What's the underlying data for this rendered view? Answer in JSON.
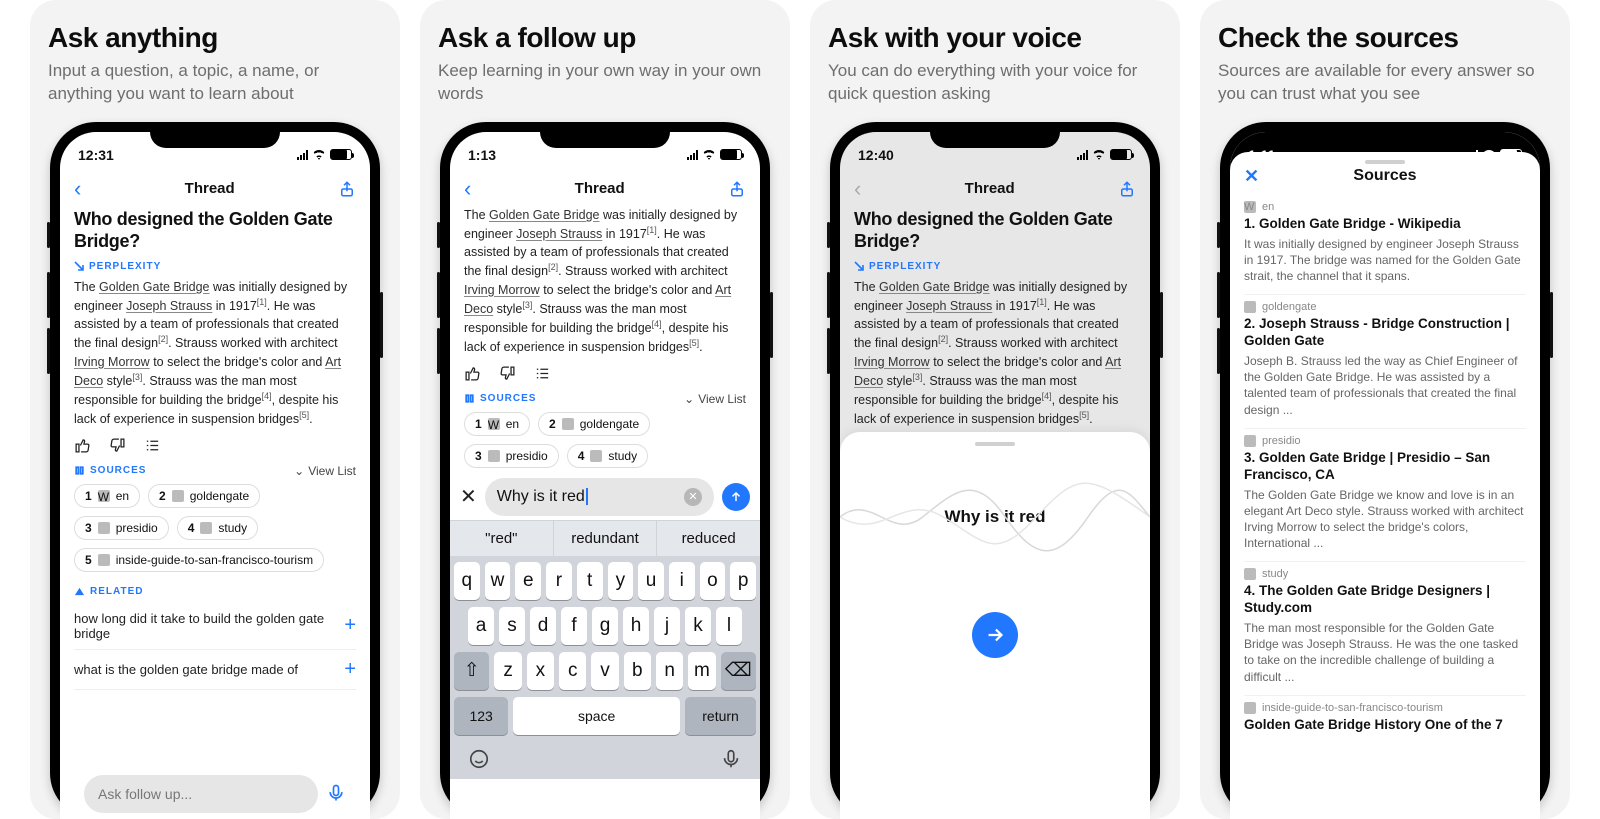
{
  "cards": [
    {
      "title": "Ask anything",
      "subtitle": "Input a question, a topic, a name, or anything you want to learn about"
    },
    {
      "title": "Ask a follow up",
      "subtitle": "Keep learning in your own way in your own words"
    },
    {
      "title": "Ask with your voice",
      "subtitle": "You can do everything with your voice for quick question asking"
    },
    {
      "title": "Check the sources",
      "subtitle": "Sources are available for every answer so you can trust what you see"
    }
  ],
  "times": {
    "s1": "12:31",
    "s2": "1:13",
    "s3": "12:40",
    "s4": "1:11"
  },
  "nav": {
    "title": "Thread"
  },
  "query": "Who designed the Golden Gate Bridge?",
  "brand": "PERPLEXITY",
  "answer": {
    "p1a": "The ",
    "link1": "Golden Gate Bridge",
    "p1b": " was initially designed by engineer ",
    "link2": "Joseph Strauss",
    "p1c": " in 1917",
    "cite1": "[1]",
    "p1d": ". He was assisted by a team of professionals that created the final design",
    "cite2": "[2]",
    "p1e": ". Strauss worked with architect ",
    "link3": "Irving Morrow",
    "p1f": " to select the bridge's color and ",
    "link4": "Art Deco",
    "p1g": " style",
    "cite3": "[3]",
    "p1h": ". Strauss was the man most responsible for building the bridge",
    "cite4": "[4]",
    "p1i": ", despite his lack of experience in suspension bridges",
    "cite5": "[5]",
    "p1j": "."
  },
  "sources_label": "SOURCES",
  "viewlist": "View List",
  "chips": [
    {
      "n": "1",
      "label": "en"
    },
    {
      "n": "2",
      "label": "goldengate"
    },
    {
      "n": "3",
      "label": "presidio"
    },
    {
      "n": "4",
      "label": "study"
    },
    {
      "n": "5",
      "label": "inside-guide-to-san-francisco-tourism"
    }
  ],
  "related_label": "RELATED",
  "related": [
    "how long did it take to build the golden gate bridge",
    "what is the golden gate bridge made of"
  ],
  "follow_placeholder": "Ask follow up...",
  "typed": "Why is it red",
  "suggestions": [
    "\"red\"",
    "redundant",
    "reduced"
  ],
  "kbd": {
    "r1": [
      "q",
      "w",
      "e",
      "r",
      "t",
      "y",
      "u",
      "i",
      "o",
      "p"
    ],
    "r2": [
      "a",
      "s",
      "d",
      "f",
      "g",
      "h",
      "j",
      "k",
      "l"
    ],
    "r3": [
      "z",
      "x",
      "c",
      "v",
      "b",
      "n",
      "m"
    ],
    "num": "123",
    "space": "space",
    "ret": "return"
  },
  "voice_text": "Why is it red",
  "sources_panel": {
    "title": "Sources",
    "items": [
      {
        "site": "en",
        "title": "1. Golden Gate Bridge - Wikipedia",
        "desc": "It was initially designed by engineer Joseph Strauss in 1917. The bridge was named for the Golden Gate strait, the channel that it spans."
      },
      {
        "site": "goldengate",
        "title": "2. Joseph Strauss - Bridge Construction | Golden Gate",
        "desc": "Joseph B. Strauss led the way as Chief Engineer of the Golden Gate Bridge. He was assisted by a talented team of professionals that created the final design ..."
      },
      {
        "site": "presidio",
        "title": "3. Golden Gate Bridge | Presidio – San Francisco, CA",
        "desc": "The Golden Gate Bridge we know and love is in an elegant Art Deco style. Strauss worked with architect Irving Morrow to select the bridge's colors, International ..."
      },
      {
        "site": "study",
        "title": "4. The Golden Gate Bridge Designers | Study.com",
        "desc": "The man most responsible for the Golden Gate Bridge was Joseph Strauss. He was the one tasked to take on the incredible challenge of building a difficult ..."
      },
      {
        "site": "inside-guide-to-san-francisco-tourism",
        "title": "Golden Gate Bridge History One of the 7",
        "desc": ""
      }
    ]
  }
}
